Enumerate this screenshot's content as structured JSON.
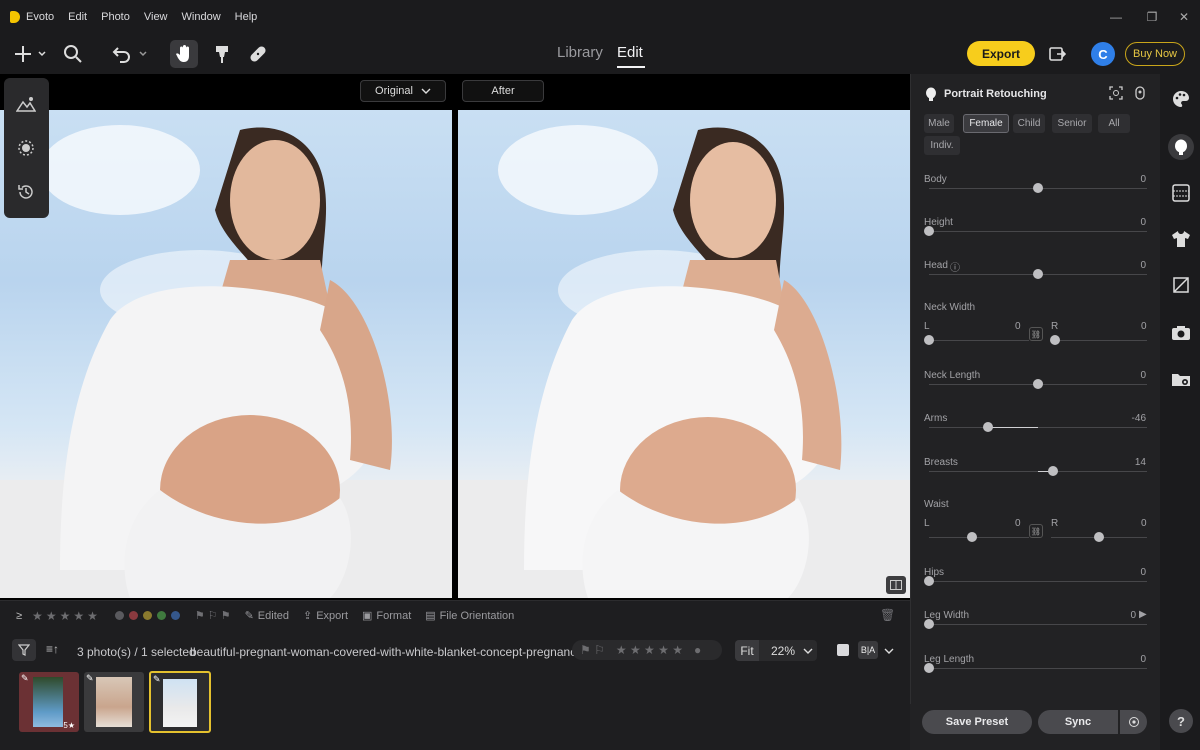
{
  "app": {
    "title": "Evoto"
  },
  "menu": [
    "Edit",
    "Photo",
    "View",
    "Window",
    "Help"
  ],
  "toolbar": {
    "mode_library": "Library",
    "mode_edit": "Edit",
    "export_label": "Export",
    "avatar_letter": "C",
    "buy_label": "Buy Now"
  },
  "compare": {
    "left_label": "Original",
    "right_label": "After"
  },
  "panel": {
    "title": "Portrait Retouching",
    "chips": [
      "Male",
      "Female",
      "Child",
      "Senior",
      "All",
      "Indiv."
    ],
    "selected_chip": "Female",
    "sliders": [
      {
        "label": "Body",
        "value": "0",
        "level": 0
      },
      {
        "label": "Height",
        "value": "0",
        "level": -1
      },
      {
        "label": "Head",
        "value": "0",
        "level": 0
      },
      {
        "label": "Neck Width",
        "left_label": "L",
        "left_value": "0",
        "right_label": "R",
        "right_value": "0"
      },
      {
        "label": "Neck Length",
        "value": "0",
        "level": 0
      },
      {
        "label": "Arms",
        "value": "-46",
        "level": -0.46
      },
      {
        "label": "Breasts",
        "value": "14",
        "level": 0.14
      },
      {
        "label": "Waist",
        "left_label": "L",
        "left_value": "0",
        "right_label": "R",
        "right_value": "0"
      },
      {
        "label": "Hips",
        "value": "0",
        "level": -1
      },
      {
        "label": "Leg Width",
        "value": "0",
        "level": -1
      },
      {
        "label": "Leg Length",
        "value": "0",
        "level": -1
      }
    ],
    "save_preset": "Save Preset",
    "sync": "Sync"
  },
  "bottombar": {
    "edited": "Edited",
    "export": "Export",
    "format": "Format",
    "orientation": "File Orientation"
  },
  "status": {
    "count": "3 photo(s) / 1 selected",
    "filename": "beautiful-pregnant-woman-covered-with-white-blanket-concept-pregnancy.jpg",
    "fit": "Fit",
    "zoom": "22%"
  },
  "thumbs": [
    {
      "stars": "5"
    },
    {
      "stars": ""
    },
    {
      "stars": ""
    }
  ],
  "colors": {
    "accent": "#f7cd1c",
    "panel": "#222224",
    "avatar": "#2f7fe8"
  },
  "icons": [
    "plus-icon",
    "search-icon",
    "undo-icon",
    "hand-icon",
    "brush-icon",
    "bandage-icon",
    "palette-icon",
    "face-icon",
    "help-icon"
  ]
}
